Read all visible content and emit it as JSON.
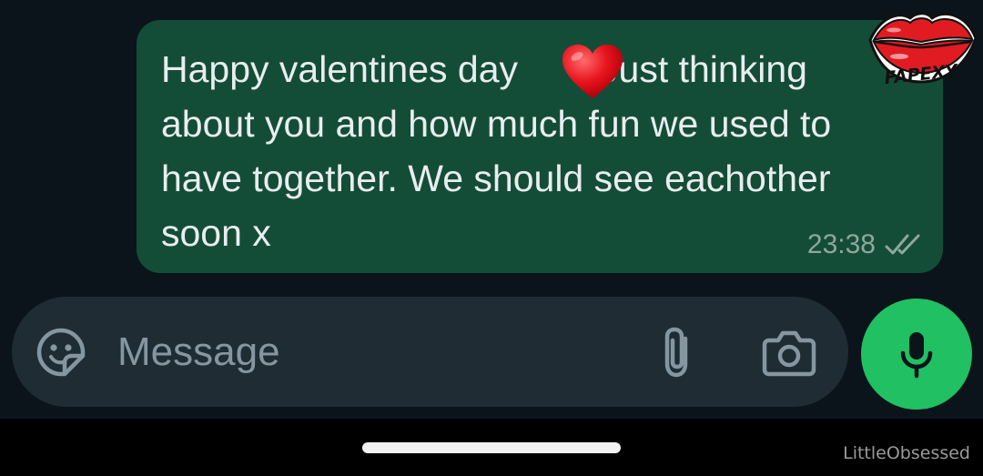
{
  "message": {
    "text": "Happy valentines day ❤️ Just thinking about you and how much fun we used to have together. We should see eachother soon x",
    "line1_start": "Happy valentines day",
    "line1_end": "Just thinking",
    "line2": "about you and how much fun we used to",
    "line3": "have together. We should see eachother",
    "line4": "soon x",
    "time": "23:38",
    "status_icon": "double-check-icon",
    "bubble_color": "#144d37"
  },
  "logo": {
    "text": "FAPEXY",
    "icon": "lips-icon",
    "color": "#e11b22"
  },
  "composer": {
    "placeholder": "Message",
    "icons": [
      "sticker-icon",
      "paperclip-icon",
      "camera-icon"
    ],
    "background": "#1f2c34"
  },
  "mic_button": {
    "icon": "microphone-icon",
    "color": "#21c063"
  },
  "watermark": "LittleObsessed"
}
